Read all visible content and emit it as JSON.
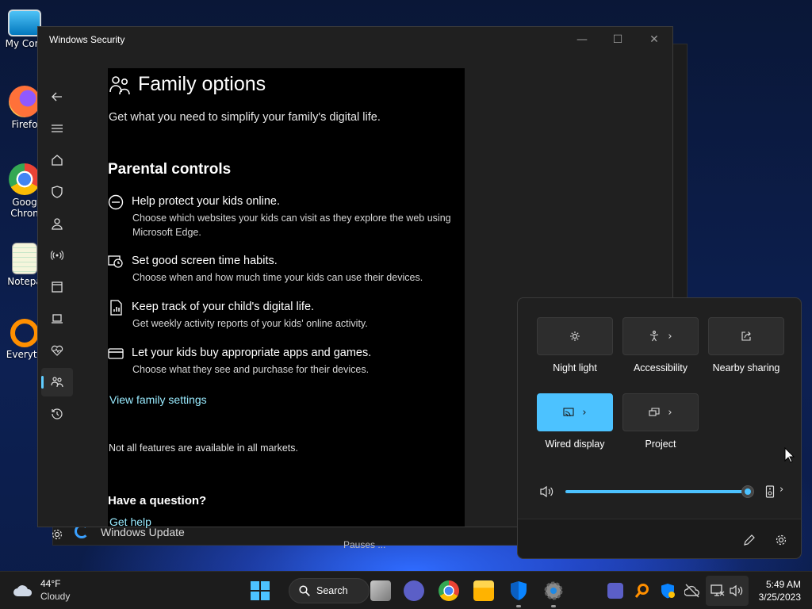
{
  "desktop": {
    "icons": [
      {
        "label": "My Com",
        "icon": "computer-icon"
      },
      {
        "label": "Firefo",
        "icon": "firefox-icon"
      },
      {
        "label": "Goog Chron",
        "icon": "chrome-icon"
      },
      {
        "label": "Notepa",
        "icon": "notepad-icon"
      },
      {
        "label": "Everyth",
        "icon": "everything-icon"
      }
    ]
  },
  "back_window": {
    "label": "Windows Update",
    "extra": "Pauses ..."
  },
  "window": {
    "title": "Windows Security",
    "controls": {
      "minimize": "—",
      "maximize": "☐",
      "close": "✕"
    },
    "page_title": "Family options",
    "subtitle": "Get what you need to simplify your family's digital life.",
    "section_heading": "Parental controls",
    "features": [
      {
        "title": "Help protect your kids online.",
        "desc": "Choose which websites your kids can visit as they explore the web using Microsoft Edge.",
        "icon": "globe-icon"
      },
      {
        "title": "Set good screen time habits.",
        "desc": "Choose when and how much time your kids can use their devices.",
        "icon": "clock-icon"
      },
      {
        "title": "Keep track of your child's digital life.",
        "desc": "Get weekly activity reports of your kids' online activity.",
        "icon": "report-icon"
      },
      {
        "title": "Let your kids buy appropriate apps and games.",
        "desc": "Choose what they see and purchase for their devices.",
        "icon": "card-icon"
      }
    ],
    "view_family_link": "View family settings",
    "note": "Not all features are available in all markets.",
    "question_heading": "Have a question?",
    "help_link": "Get help"
  },
  "quick_settings": {
    "tiles": [
      {
        "label": "Night light",
        "icon": "brightness-icon",
        "on": false,
        "chevron": false
      },
      {
        "label": "Accessibility",
        "icon": "accessibility-icon",
        "on": false,
        "chevron": true
      },
      {
        "label": "Nearby sharing",
        "icon": "share-icon",
        "on": false,
        "chevron": false
      },
      {
        "label": "Wired display",
        "icon": "cast-icon",
        "on": true,
        "chevron": true
      },
      {
        "label": "Project",
        "icon": "project-icon",
        "on": false,
        "chevron": true
      }
    ],
    "volume_percent": 100,
    "chevron": "›"
  },
  "taskbar": {
    "weather_temp": "44°F",
    "weather_desc": "Cloudy",
    "search_label": "Search",
    "time": "5:49 AM",
    "date": "3/25/2023"
  },
  "colors": {
    "accent": "#4cc2ff",
    "link": "#99ebff",
    "window_bg": "#202020"
  }
}
